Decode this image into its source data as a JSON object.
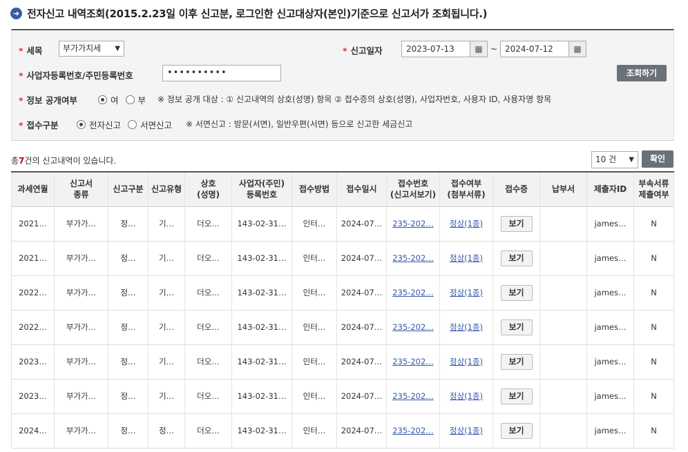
{
  "title": "전자신고 내역조회(2015.2.23일 이후 신고분, 로그인한  신고대상자(본인)기준으로  신고서가 조회됩니다.)",
  "search": {
    "tax_label": "세목",
    "tax_value": "부가가치세",
    "date_label": "신고일자",
    "date_from": "2023-07-13",
    "date_to": "2024-07-12",
    "date_sep": "~",
    "id_label": "사업자등록번호/주민등록번호",
    "id_value": "••••••••••",
    "search_button": "조회하기",
    "disclosure_label": "정보 공개여부",
    "disclosure_yes": "여",
    "disclosure_no": "부",
    "disclosure_note": "※ 정보 공개 대상 : ① 신고내역의 상호(성명) 항목 ② 접수증의 상호(성명), 사업자번호, 사용자 ID, 사용자명 항목",
    "receipt_label": "접수구분",
    "receipt_electronic": "전자신고",
    "receipt_paper": "서면신고",
    "receipt_note": "※ 서면신고 : 방문(서면), 일반우편(서면) 등으로 신고한 세금신고"
  },
  "result": {
    "count_prefix": "총",
    "count": "7",
    "count_suffix": "건의 신고내역이 있습니다.",
    "page_size": "10 건",
    "confirm_button": "확인"
  },
  "table": {
    "headers": [
      [
        "과세연월",
        ""
      ],
      [
        "신고서",
        "종류"
      ],
      [
        "신고구분",
        ""
      ],
      [
        "신고유형",
        ""
      ],
      [
        "상호",
        "(성명)"
      ],
      [
        "사업자(주민)",
        "등록번호"
      ],
      [
        "접수방법",
        ""
      ],
      [
        "접수일시",
        ""
      ],
      [
        "접수번호",
        "(신고서보기)"
      ],
      [
        "접수여부",
        "(첨부서류)"
      ],
      [
        "접수증",
        ""
      ],
      [
        "납부서",
        ""
      ],
      [
        "제출자ID",
        ""
      ],
      [
        "부속서류",
        "제출여부"
      ]
    ],
    "rows": [
      [
        "2021…",
        "부가가…",
        "정…",
        "기…",
        "더오…",
        "143-02-31…",
        "인터…",
        "2024-07…",
        "235-202…",
        "정상(1종)",
        "보기",
        "",
        "james…",
        "N"
      ],
      [
        "2021…",
        "부가가…",
        "정…",
        "기…",
        "더오…",
        "143-02-31…",
        "인터…",
        "2024-07…",
        "235-202…",
        "정상(1종)",
        "보기",
        "",
        "james…",
        "N"
      ],
      [
        "2022…",
        "부가가…",
        "정…",
        "기…",
        "더오…",
        "143-02-31…",
        "인터…",
        "2024-07…",
        "235-202…",
        "정상(1종)",
        "보기",
        "",
        "james…",
        "N"
      ],
      [
        "2022…",
        "부가가…",
        "정…",
        "기…",
        "더오…",
        "143-02-31…",
        "인터…",
        "2024-07…",
        "235-202…",
        "정상(1종)",
        "보기",
        "",
        "james…",
        "N"
      ],
      [
        "2023…",
        "부가가…",
        "정…",
        "기…",
        "더오…",
        "143-02-31…",
        "인터…",
        "2024-07…",
        "235-202…",
        "정상(1종)",
        "보기",
        "",
        "james…",
        "N"
      ],
      [
        "2023…",
        "부가가…",
        "정…",
        "기…",
        "더오…",
        "143-02-31…",
        "인터…",
        "2024-07…",
        "235-202…",
        "정상(1종)",
        "보기",
        "",
        "james…",
        "N"
      ],
      [
        "2024…",
        "부가가…",
        "정…",
        "정…",
        "더오…",
        "143-02-31…",
        "인터…",
        "2024-07…",
        "235-202…",
        "정상(1종)",
        "보기",
        "",
        "james…",
        "N"
      ]
    ]
  },
  "colors": {
    "accent": "#3a5ba0",
    "required": "#dd3333",
    "button": "#6b7178",
    "link": "#3355aa"
  },
  "icons": {
    "title": "arrow-right-circle-icon",
    "calendar": "calendar-icon",
    "dropdown": "chevron-down-icon"
  }
}
